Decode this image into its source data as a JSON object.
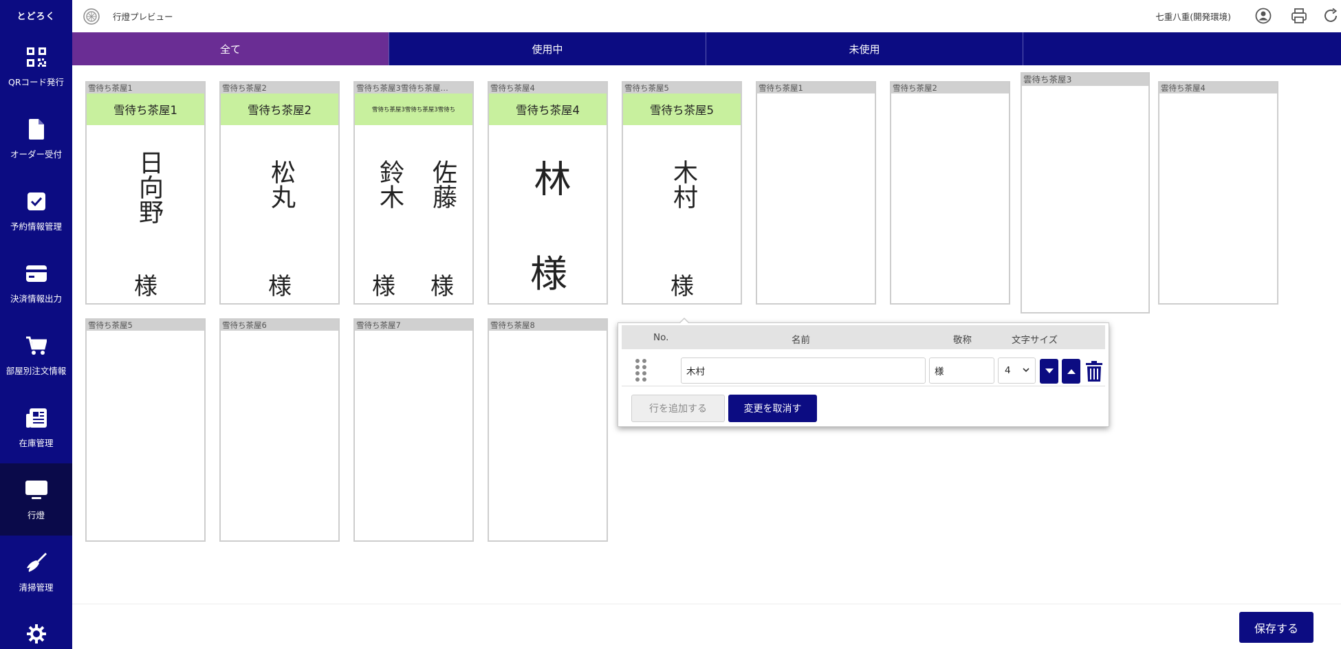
{
  "app": {
    "brand": "とどろく",
    "title": "行燈プレビュー",
    "environment": "七重八重(開発環境)"
  },
  "sidebar": {
    "items": [
      {
        "label": "QRコード発行",
        "icon": "qr-code-icon"
      },
      {
        "label": "オーダー受付",
        "icon": "document-icon"
      },
      {
        "label": "予約情報管理",
        "icon": "checkbox-icon"
      },
      {
        "label": "決済情報出力",
        "icon": "credit-card-icon"
      },
      {
        "label": "部屋別注文情報",
        "icon": "cart-icon"
      },
      {
        "label": "在庫管理",
        "icon": "newspaper-icon"
      },
      {
        "label": "行燈",
        "icon": "monitor-icon"
      },
      {
        "label": "清掃管理",
        "icon": "broom-icon"
      }
    ],
    "active_index": 6,
    "settings_icon": "gear-icon"
  },
  "header_icons": [
    "account-icon",
    "print-icon",
    "refresh-icon"
  ],
  "tabs": [
    {
      "label": "全て",
      "active": true
    },
    {
      "label": "使用中",
      "active": false
    },
    {
      "label": "未使用",
      "active": false
    }
  ],
  "cards": [
    {
      "header": "雪待ち茶屋1",
      "band": "雪待ち茶屋1",
      "names": [
        "日向野"
      ],
      "honorifics": [
        "様"
      ],
      "size": "normal"
    },
    {
      "header": "雪待ち茶屋2",
      "band": "雪待ち茶屋2",
      "names": [
        "松丸"
      ],
      "honorifics": [
        "様"
      ],
      "size": "normal"
    },
    {
      "header": "雪待ち茶屋3雪待ち茶屋…",
      "band": "雪待ち茶屋3雪待ち茶屋3雪待ち",
      "names": [
        "鈴木",
        "佐藤"
      ],
      "honorifics": [
        "様",
        "様"
      ],
      "size": "normal"
    },
    {
      "header": "雪待ち茶屋4",
      "band": "雪待ち茶屋4",
      "names": [
        "林"
      ],
      "honorifics": [
        "様"
      ],
      "size": "large"
    },
    {
      "header": "雪待ち茶屋5",
      "band": "雪待ち茶屋5",
      "names": [
        "木村"
      ],
      "honorifics": [
        "様"
      ],
      "size": "normal"
    },
    {
      "header": "雪待ち茶屋1",
      "band": "",
      "names": [],
      "honorifics": []
    },
    {
      "header": "雪待ち茶屋2",
      "band": "",
      "names": [],
      "honorifics": []
    },
    {
      "header": "雲待ち茶屋3",
      "band": "",
      "names": [],
      "honorifics": []
    },
    {
      "header": "雲待ち茶屋4",
      "band": "",
      "names": [],
      "honorifics": []
    },
    {
      "header": "雪待ち茶屋5",
      "band": "",
      "names": [],
      "honorifics": []
    },
    {
      "header": "雪待ち茶屋6",
      "band": "",
      "names": [],
      "honorifics": []
    },
    {
      "header": "雪待ち茶屋7",
      "band": "",
      "names": [],
      "honorifics": []
    },
    {
      "header": "雪待ち茶屋8",
      "band": "",
      "names": [],
      "honorifics": []
    }
  ],
  "editor": {
    "columns": {
      "no": "No.",
      "name": "名前",
      "honorific": "敬称",
      "font_size": "文字サイズ"
    },
    "row": {
      "name": "木村",
      "honorific": "様",
      "font_size": "4"
    },
    "add_row_label": "行を追加する",
    "undo_label": "変更を取消す"
  },
  "save_label": "保存する"
}
